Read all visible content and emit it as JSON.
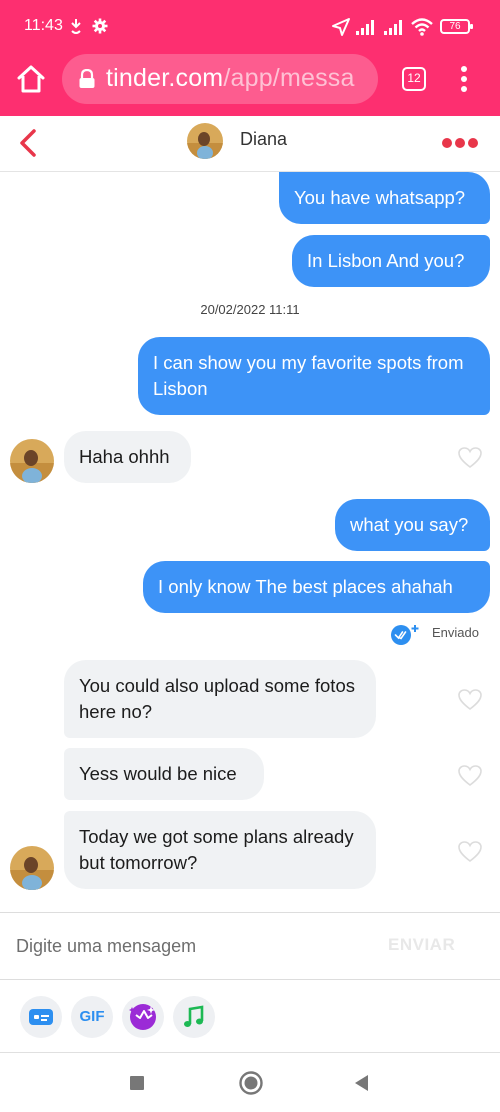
{
  "status_bar": {
    "time": "11:43",
    "battery": "76"
  },
  "browser": {
    "url_domain": "tinder.com",
    "url_path": "/app/messa",
    "tab_count": "12"
  },
  "chat": {
    "contact_name": "Diana",
    "date_stamp": "20/02/2022 11:11",
    "messages": [
      {
        "direction": "out",
        "text": "You have whatsapp?"
      },
      {
        "direction": "out",
        "text": "In Lisbon And you?"
      },
      {
        "direction": "out",
        "text": "I can show you my favorite spots from Lisbon"
      },
      {
        "direction": "in",
        "text": "Haha ohhh"
      },
      {
        "direction": "out",
        "text": "what you say?"
      },
      {
        "direction": "out",
        "text": "I only know The best places ahahah"
      },
      {
        "direction": "in",
        "text": "You could also upload some fotos here no?"
      },
      {
        "direction": "in",
        "text": "Yess would be nice"
      },
      {
        "direction": "in",
        "text": "Today we got some plans already but tomorrow?"
      }
    ],
    "sent_status": "Enviado"
  },
  "compose": {
    "placeholder": "Digite uma mensagem",
    "send_label": "ENVIAR"
  },
  "toolbar": {
    "gif_label": "GIF"
  },
  "colors": {
    "brand_pink": "#fd2f70",
    "outgoing_bubble": "#3d93f7",
    "incoming_bubble": "#f0f2f4",
    "accent_red": "#e8364a"
  }
}
